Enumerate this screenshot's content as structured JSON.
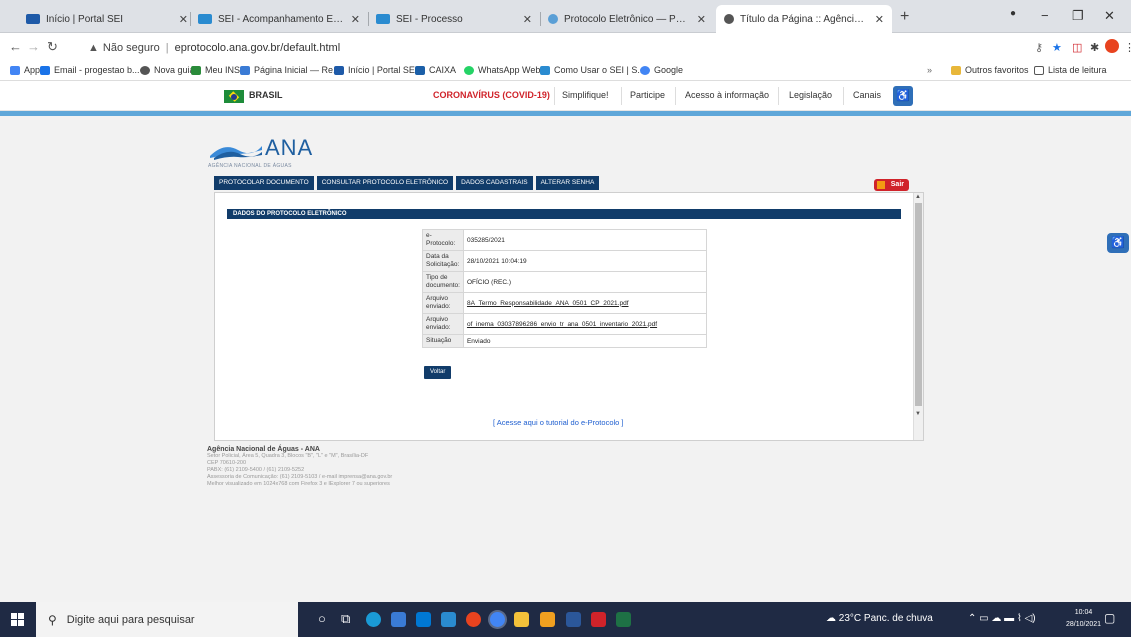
{
  "browser": {
    "tabs": [
      {
        "title": "Início | Portal SEI",
        "color": "#1e5aa8"
      },
      {
        "title": "SEI - Acompanhamento Especial",
        "color": "#2a8bd0"
      },
      {
        "title": "SEI - Processo",
        "color": "#2a8bd0"
      },
      {
        "title": "Protocolo Eletrônico — Português",
        "color": "#5a9fd6"
      },
      {
        "title": "Título da Página :: Agência Nacio",
        "color": "#555555"
      }
    ],
    "new_tab": "+",
    "window_controls": {
      "minimize": "−",
      "restore": "❐",
      "close": "✕"
    },
    "address": {
      "security_label": "Não seguro",
      "url": "eprotocolo.ana.gov.br/default.html"
    },
    "bookmarks": [
      {
        "label": "Apps",
        "color": "#4285f4"
      },
      {
        "label": "Email - progestao b...",
        "color": "#1a73e8"
      },
      {
        "label": "Nova guia",
        "color": "#555555"
      },
      {
        "label": "Meu INSS",
        "color": "#2a8b3a"
      },
      {
        "label": "Página Inicial — Re...",
        "color": "#3a7bd5"
      },
      {
        "label": "Início | Portal SEI",
        "color": "#1e5aa8"
      },
      {
        "label": "CAIXA",
        "color": "#1b5fa8"
      },
      {
        "label": "WhatsApp Web",
        "color": "#25d366"
      },
      {
        "label": "Como Usar o SEI | S...",
        "color": "#2a8bd0"
      },
      {
        "label": "Google",
        "color": "#4285f4"
      }
    ],
    "bookmarks_right": [
      {
        "label": "Outros favoritos",
        "color": "#e8b73a"
      },
      {
        "label": "Lista de leitura",
        "color": "#555555"
      }
    ]
  },
  "govbar": {
    "brasil": "BRASIL",
    "links": [
      "CORONAVÍRUS (COVID-19)",
      "Simplifique!",
      "Participe",
      "Acesso à informação",
      "Legislação",
      "Canais"
    ],
    "accent": "#d0232a"
  },
  "site": {
    "logo_text": "ANA",
    "logo_sub": "AGÊNCIA NACIONAL DE ÁGUAS",
    "menu": [
      "PROTOCOLAR DOCUMENTO",
      "CONSULTAR PROTOCOLO ELETRÔNICO",
      "DADOS CADASTRAIS",
      "ALTERAR SENHA"
    ],
    "sair": "Sair",
    "section_title": "DADOS DO PROTOCOLO ELETRÔNICO",
    "rows": [
      {
        "label": "e-Protocolo:",
        "value": "035285/2021"
      },
      {
        "label": "Data da Solicitação:",
        "value": "28/10/2021 10:04:19"
      },
      {
        "label": "Tipo de documento:",
        "value": "OFÍCIO (REC.)"
      },
      {
        "label": "Arquivo enviado:",
        "value": "8A_Termo_Responsabilidade_ANA_0501_CP_2021.pdf",
        "link": true
      },
      {
        "label": "Arquivo enviado:",
        "value": "of_inema_03037896286_envio_tr_ana_0501_inventario_2021.pdf",
        "link": true
      },
      {
        "label": "Situação",
        "value": "Enviado"
      }
    ],
    "voltar": "Voltar",
    "tutorial": "[ Acesse aqui o tutorial do e-Protocolo ]",
    "footer": {
      "title": "Agência Nacional de Águas - ANA",
      "lines": [
        "Setor Policial, Área 5, Quadra 3, Blocos \"B\", \"L\" e \"M\", Brasília-DF",
        "CEP 70610-200",
        "PABX: (61) 2109-5400 / (61) 2109-5252",
        "Assessoria de Comunicação: (61) 2109-5103 / e-mail imprensa@ana.gov.br",
        "Melhor visualizado em 1024x768 com Firefox 3 e IExplorer 7 ou superiores"
      ]
    }
  },
  "taskbar": {
    "search_placeholder": "Digite aqui para pesquisar",
    "weather": "23°C  Panc. de chuva",
    "time": "10:04",
    "date": "28/10/2021"
  }
}
